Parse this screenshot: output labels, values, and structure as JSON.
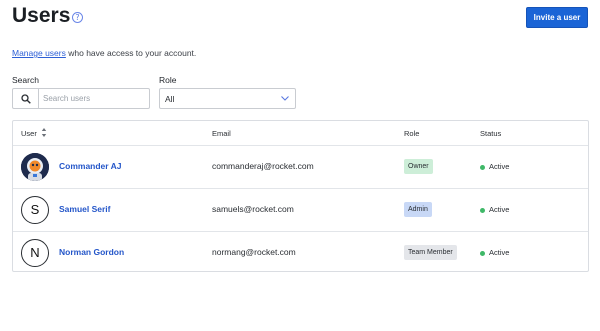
{
  "header": {
    "title": "Users",
    "invite_label": "Invite a user"
  },
  "intro": {
    "link_text": "Manage users",
    "rest_text": " who have access to your account."
  },
  "filters": {
    "search_label": "Search",
    "search_placeholder": "Search users",
    "role_label": "Role",
    "role_value": "All"
  },
  "table": {
    "headers": {
      "user": "User",
      "email": "Email",
      "role": "Role",
      "status": "Status"
    },
    "rows": [
      {
        "avatar": "",
        "name": "Commander AJ",
        "email": "commanderaj@rocket.com",
        "role": "Owner",
        "role_color": "#cdeed8",
        "status": "Active",
        "status_color": "#3fb868"
      },
      {
        "avatar": "S",
        "name": "Samuel Serif",
        "email": "samuels@rocket.com",
        "role": "Admin",
        "role_color": "#c8d8f6",
        "status": "Active",
        "status_color": "#3fb868"
      },
      {
        "avatar": "N",
        "name": "Norman Gordon",
        "email": "normang@rocket.com",
        "role": "Team Member",
        "role_color": "#e4e6ea",
        "status": "Active",
        "status_color": "#3fb868"
      }
    ]
  },
  "icons": {
    "help": "help-circle-icon",
    "search": "search-icon",
    "chevron": "chevron-down-icon",
    "sort": "sort-icon"
  },
  "colors": {
    "primary": "#1a64d6",
    "link": "#2456c9"
  }
}
